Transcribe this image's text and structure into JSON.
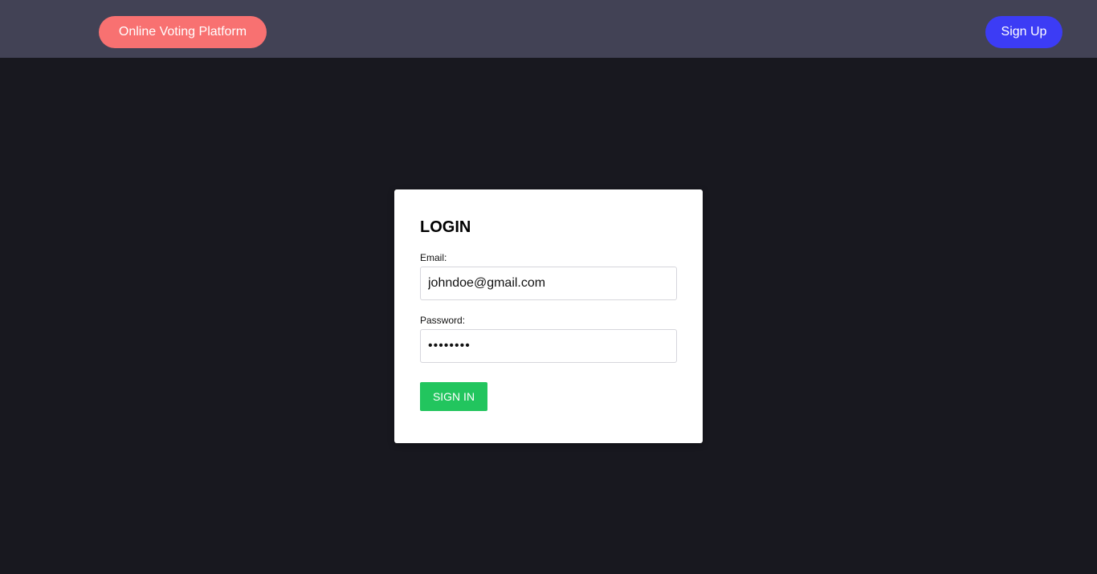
{
  "navbar": {
    "brand_label": "Online Voting Platform",
    "signup_label": "Sign Up"
  },
  "login_card": {
    "title": "LOGIN",
    "email_label": "Email:",
    "email_value": "johndoe@gmail.com",
    "password_label": "Password:",
    "password_value": "password",
    "submit_label": "SIGN IN"
  },
  "colors": {
    "page_background": "#18181f",
    "navbar_background": "#424255",
    "brand_pill": "#f87171",
    "signup_button": "#3c3cf5",
    "signin_button": "#22c55e"
  }
}
